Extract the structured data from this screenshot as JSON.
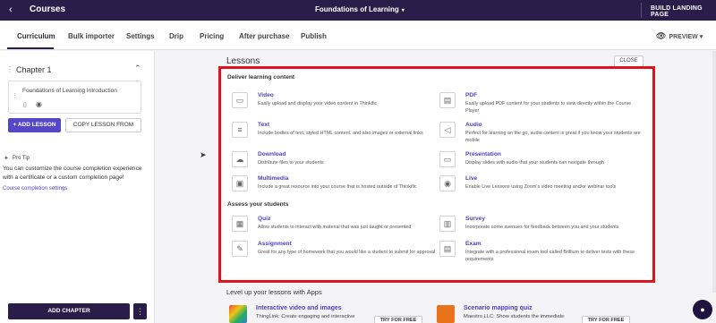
{
  "topbar": {
    "back_icon": "‹",
    "app_title": "Courses",
    "course_title": "Foundations of Learning",
    "course_caret": "▾",
    "build_label": "BUILD LANDING PAGE"
  },
  "tabs": {
    "items": [
      "Curriculum",
      "Bulk importer",
      "Settings",
      "Drip",
      "Pricing",
      "After purchase",
      "Publish"
    ],
    "active": "Curriculum",
    "preview_label": "PREVIEW",
    "preview_caret": "▾"
  },
  "sidebar": {
    "chapter_title": "Chapter 1",
    "lesson_name": "Foundations of Learning Introduction",
    "add_lesson_label": "+ ADD LESSON",
    "copy_lesson_label": "COPY LESSON FROM",
    "pro_tip_label": "Pro Tip",
    "pro_tip_text": "You can customize the course completion experience with a certificate or a custom completion page!",
    "pro_tip_link": "Course completion settings",
    "add_chapter_label": "ADD CHAPTER",
    "more_label": "⋮"
  },
  "main": {
    "heading": "Lessons",
    "close_label": "CLOSE",
    "deliver_title": "Deliver learning content",
    "assess_title": "Assess your students",
    "deliver_items": [
      {
        "title": "Video",
        "desc": "Easily upload and display your video content in Thinkific",
        "icon": "video-icon",
        "glyph": "▭"
      },
      {
        "title": "PDF",
        "desc": "Easily upload PDF content for your students to view directly within the Course Player",
        "icon": "pdf-icon",
        "glyph": "▤"
      },
      {
        "title": "Text",
        "desc": "Include bodies of text, styled HTML content, and also images or external links",
        "icon": "text-icon",
        "glyph": "≡"
      },
      {
        "title": "Audio",
        "desc": "Perfect for learning on the go, audio content is great if you know your students are mobile",
        "icon": "audio-icon",
        "glyph": "◁"
      },
      {
        "title": "Download",
        "desc": "Distribute files to your students",
        "icon": "download-icon",
        "glyph": "☁"
      },
      {
        "title": "Presentation",
        "desc": "Display slides with audio that your students can navigate through",
        "icon": "presentation-icon",
        "glyph": "▭"
      },
      {
        "title": "Multimedia",
        "desc": "Include a great resource into your course that is hosted outside of Thinkific",
        "icon": "multimedia-icon",
        "glyph": "▣"
      },
      {
        "title": "Live",
        "desc": "Enable Live Lessons using Zoom's video meeting and/or webinar tools",
        "icon": "live-icon",
        "glyph": "◉"
      }
    ],
    "assess_items": [
      {
        "title": "Quiz",
        "desc": "Allow students to interact with material that was just taught or presented",
        "icon": "quiz-icon",
        "glyph": "▦"
      },
      {
        "title": "Survey",
        "desc": "Incorporate some avenues for feedback between you and your students",
        "icon": "survey-icon",
        "glyph": "▥"
      },
      {
        "title": "Assignment",
        "desc": "Great for any type of homework that you would like a student to submit for approval",
        "icon": "assignment-icon",
        "glyph": "✎"
      },
      {
        "title": "Exam",
        "desc": "Integrate with a professional exam tool called Brillium to deliver tests with these requirements",
        "icon": "exam-icon",
        "glyph": "▤"
      }
    ],
    "apps_heading": "Level up your lessons with Apps",
    "apps": [
      {
        "name": "Interactive video and images",
        "desc": "ThingLink: Create engaging and interactive",
        "button": "TRY FOR FREE",
        "color": "#3a7bd5"
      },
      {
        "name": "Scenario mapping quiz",
        "desc": "Maestro LLC: Show students the immediate",
        "button": "TRY FOR FREE",
        "color": "#e8731a"
      }
    ]
  },
  "colors": {
    "topbar": "#2a1d49",
    "accent": "#5548c8",
    "highlight": "#e0121e"
  }
}
